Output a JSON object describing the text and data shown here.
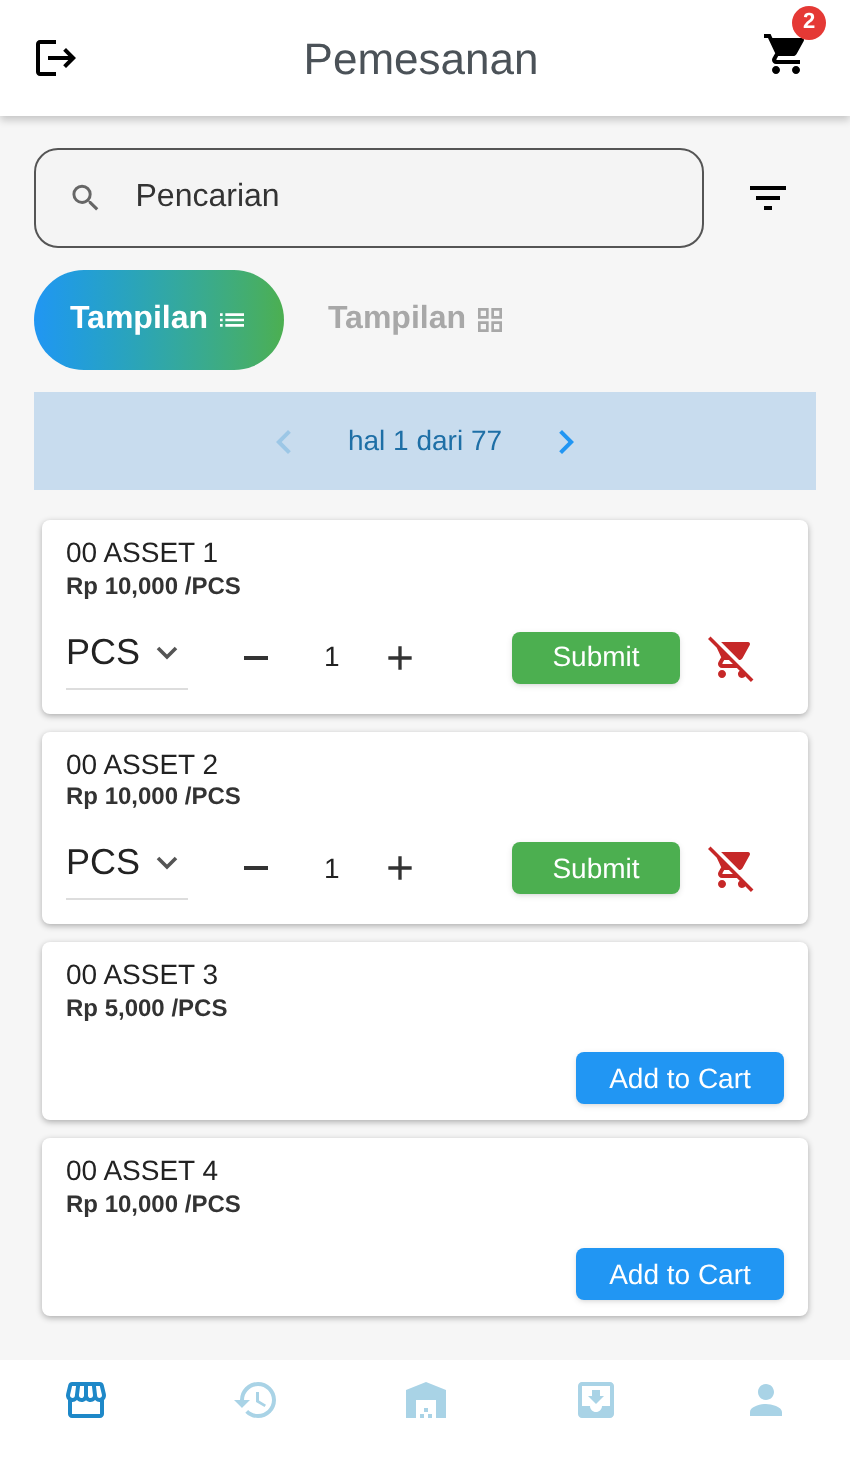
{
  "header": {
    "title": "Pemesanan",
    "cart_count": "2"
  },
  "search": {
    "placeholder": "Pencarian"
  },
  "view_toggle": [
    {
      "label": "Tampilan",
      "selected": true
    },
    {
      "label": "Tampilan",
      "selected": false
    }
  ],
  "pager": {
    "text": "hal 1 dari 77",
    "prev_disabled": true
  },
  "items": [
    {
      "kind": "in_cart",
      "name": "00 ASSET 1",
      "price": "Rp 10,000 /PCS",
      "unit": "PCS",
      "qty": "1",
      "button": "Submit"
    },
    {
      "kind": "in_cart",
      "name": "00 ASSET 2",
      "price": "Rp 10,000 /PCS",
      "unit": "PCS",
      "qty": "1",
      "button": "Submit"
    },
    {
      "kind": "add",
      "name": "00 ASSET 3",
      "price": "Rp 5,000 /PCS",
      "button": "Add to Cart"
    },
    {
      "kind": "add",
      "name": "00 ASSET 4",
      "price": "Rp 10,000 /PCS",
      "button": "Add to Cart"
    }
  ],
  "bottom_nav": [
    {
      "selected": true
    },
    {
      "selected": false
    },
    {
      "selected": false
    },
    {
      "selected": false
    },
    {
      "selected": false
    }
  ]
}
